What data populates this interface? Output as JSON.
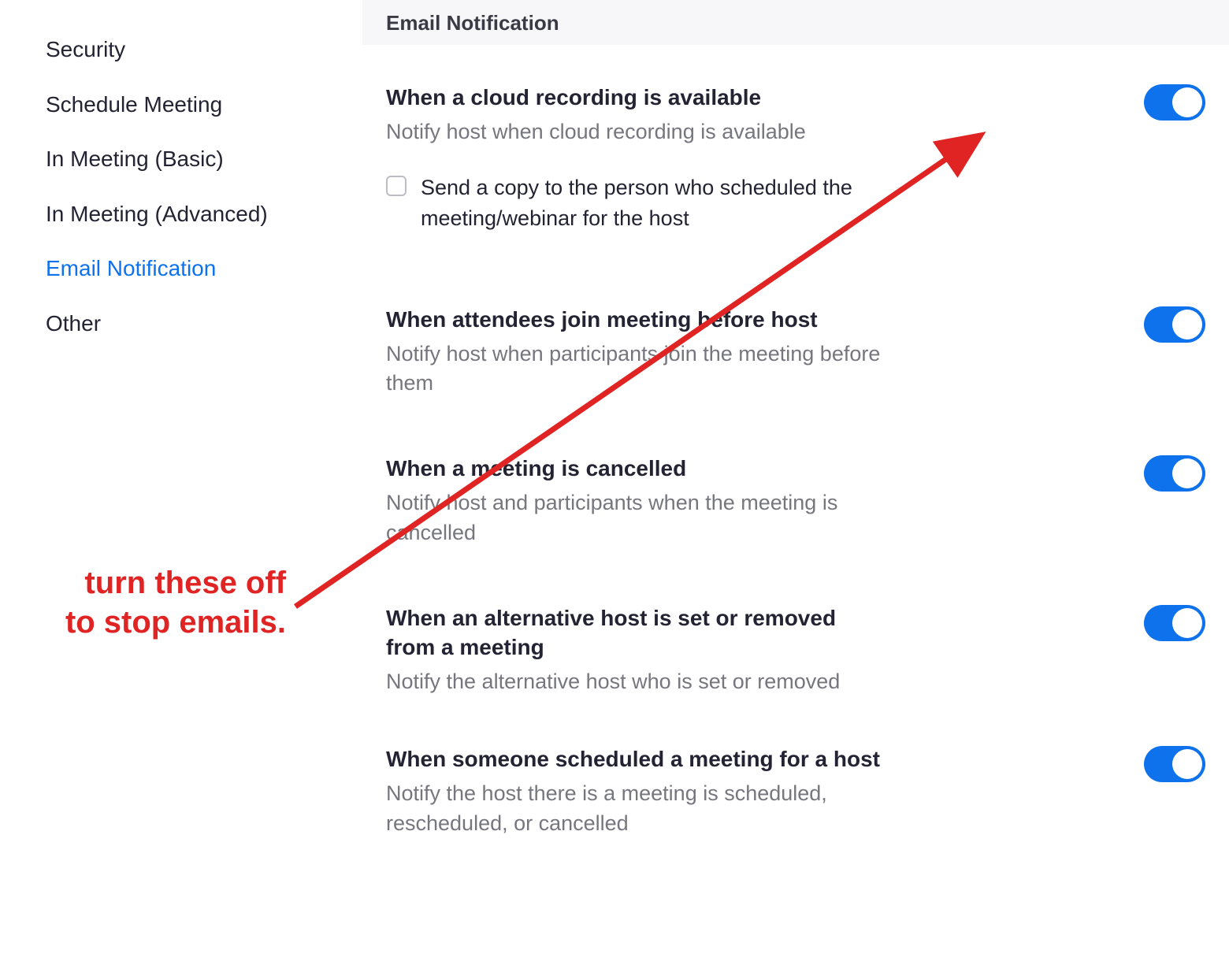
{
  "sidebar": {
    "items": [
      {
        "label": "Security",
        "active": false
      },
      {
        "label": "Schedule Meeting",
        "active": false
      },
      {
        "label": "In Meeting (Basic)",
        "active": false
      },
      {
        "label": "In Meeting (Advanced)",
        "active": false
      },
      {
        "label": "Email Notification",
        "active": true
      },
      {
        "label": "Other",
        "active": false
      }
    ]
  },
  "section": {
    "title": "Email Notification"
  },
  "settings": [
    {
      "title": "When a cloud recording is available",
      "desc": "Notify host when cloud recording is available",
      "toggle_on": true,
      "sub_option": {
        "label": "Send a copy to the person who scheduled the meeting/webinar for the host",
        "checked": false
      }
    },
    {
      "title": "When attendees join meeting before host",
      "desc": "Notify host when participants join the meeting before them",
      "toggle_on": true
    },
    {
      "title": "When a meeting is cancelled",
      "desc": "Notify host and participants when the meeting is cancelled",
      "toggle_on": true
    },
    {
      "title": "When an alternative host is set or removed from a meeting",
      "desc": "Notify the alternative host who is set or removed",
      "toggle_on": true
    },
    {
      "title": "When someone scheduled a meeting for a host",
      "desc": "Notify the host there is a meeting is scheduled, rescheduled, or cancelled",
      "toggle_on": true
    }
  ],
  "annotation": {
    "line1": "turn these off",
    "line2": "to stop emails."
  },
  "colors": {
    "accent": "#0e72ed",
    "annotation": "#e02424",
    "muted": "#76767e"
  }
}
